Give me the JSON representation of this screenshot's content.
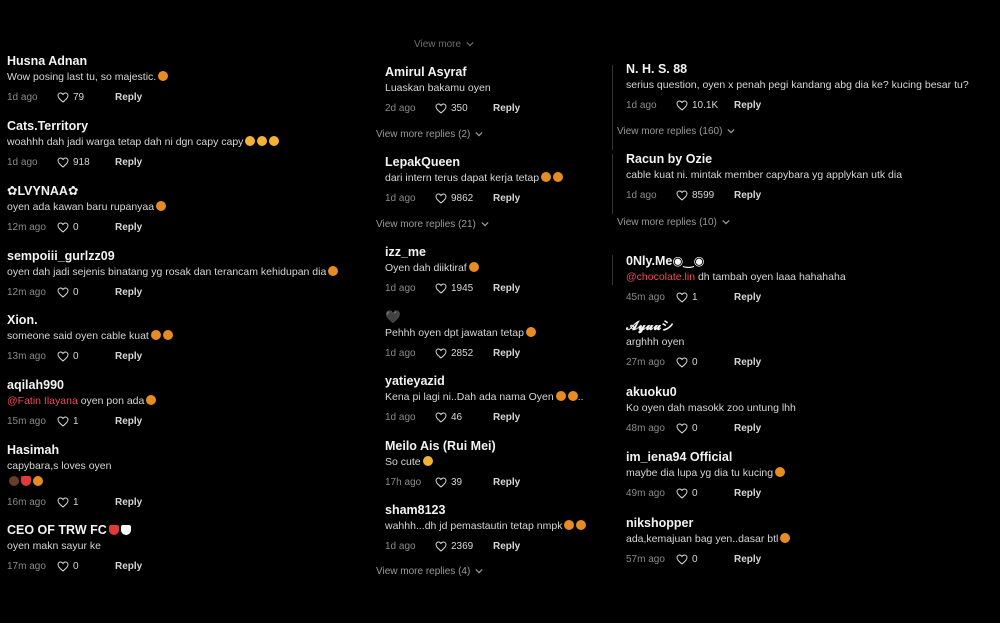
{
  "col1": [
    {
      "user": "Husna Adnan",
      "text": "Wow posing last tu, so majestic.",
      "emoji": [
        "cat"
      ],
      "time": "1d ago",
      "likes": "79"
    },
    {
      "user": "Cats.Territory",
      "text": "woahhh dah jadi warga tetap dah ni dgn capy capy",
      "emoji": [
        "love",
        "love",
        "love"
      ],
      "time": "1d ago",
      "likes": "918"
    },
    {
      "user": "✿LVYNAA✿",
      "text": "oyen ada kawan baru rupanyaa",
      "emoji": [
        "laugh"
      ],
      "time": "12m ago",
      "likes": "0"
    },
    {
      "user": "sempoiii_gurlzz09",
      "text": "oyen dah jadi sejenis binatang yg rosak dan terancam kehidupan dia",
      "emoji": [
        "laugh"
      ],
      "time": "12m ago",
      "likes": "0"
    },
    {
      "user": "Xion.",
      "text": "someone said oyen cable kuat",
      "emoji": [
        "laugh",
        "laugh"
      ],
      "time": "13m ago",
      "likes": "0"
    },
    {
      "user": "aqilah990",
      "mention": "@Fatin Ilayana",
      "text": " oyen pon ada",
      "emoji": [
        "laugh"
      ],
      "time": "15m ago",
      "likes": "1"
    },
    {
      "user": "Hasimah",
      "text": "capybara,s loves oyen",
      "line2": true,
      "emoji2": [
        "capy",
        "heart",
        "cat"
      ],
      "time": "16m ago",
      "likes": "1"
    },
    {
      "user": "CEO OF TRW FC",
      "userEmoji": [
        "heart",
        "white"
      ],
      "text": "oyen makn sayur ke",
      "time": "17m ago",
      "likes": "0"
    }
  ],
  "col2_top_more": "View more",
  "col2": [
    {
      "user": "Amirul Asyraf",
      "text": "Luaskan bakamu oyen",
      "time": "2d ago",
      "likes": "350"
    },
    {
      "user": "LepakQueen",
      "text": "dari intern terus dapat kerja tetap",
      "emoji": [
        "laugh",
        "laugh"
      ],
      "time": "1d ago",
      "likes": "9862"
    },
    {
      "user": "izz_me",
      "text": "Oyen dah diiktiraf",
      "emoji": [
        "laugh"
      ],
      "time": "1d ago",
      "likes": "1945"
    },
    {
      "user": "🖤",
      "text": "Pehhh oyen dpt jawatan tetap",
      "emoji": [
        "laugh"
      ],
      "time": "1d ago",
      "likes": "2852"
    },
    {
      "user": "yatieyazid",
      "text": "Kena pi lagi ni..Dah ada nama Oyen",
      "emoji": [
        "laugh",
        "laugh"
      ],
      "suffix": "..",
      "time": "1d ago",
      "likes": "46"
    },
    {
      "user": "Meilo Ais (Rui Mei)",
      "text": "So cute",
      "emoji": [
        "smile"
      ],
      "time": "17h ago",
      "likes": "39"
    },
    {
      "user": "sham8123",
      "text": "wahhh...dh jd pemastautin tetap nmpk",
      "emoji": [
        "laugh",
        "laugh"
      ],
      "time": "1d ago",
      "likes": "2369"
    }
  ],
  "col2_more": [
    "View more replies (2)",
    "View more replies (21)",
    "View more replies (4)"
  ],
  "col3": [
    {
      "user": "N. H. S. 88",
      "text": "serius question, oyen x penah pegi kandang abg dia ke? kucing besar tu?",
      "time": "1d ago",
      "likes": "10.1K"
    },
    {
      "user": "Racun by Ozie",
      "text": "cable kuat ni. mintak member capybara yg applykan utk dia",
      "time": "1d ago",
      "likes": "8599"
    },
    {
      "user": "0Nly.Me◉‿◉",
      "mention": "@chocolate.lin",
      "text": " dh tambah oyen laaa hahahaha",
      "time": "45m ago",
      "likes": "1"
    },
    {
      "user": "𝓐𝔂𝓾𝓾シ",
      "text": "arghhh oyen",
      "time": "27m ago",
      "likes": "0"
    },
    {
      "user": "akuoku0",
      "text": "Ko oyen dah masokk zoo untung lhh",
      "time": "48m ago",
      "likes": "0"
    },
    {
      "user": "im_iena94 Official",
      "text": "maybe dia lupa yg dia tu kucing",
      "emoji": [
        "laugh"
      ],
      "time": "49m ago",
      "likes": "0"
    },
    {
      "user": "nikshopper",
      "text": "ada,kemajuan bag yen..dasar btl",
      "emoji": [
        "laugh"
      ],
      "time": "57m ago",
      "likes": "0"
    }
  ],
  "col3_more": [
    "View more replies (160)",
    "View more replies (10)"
  ],
  "reply_label": "Reply",
  "colors": {
    "bg": "#000000",
    "text": "#e8e8e8",
    "muted": "#8a8a8a",
    "mention": "#f04a5d"
  }
}
